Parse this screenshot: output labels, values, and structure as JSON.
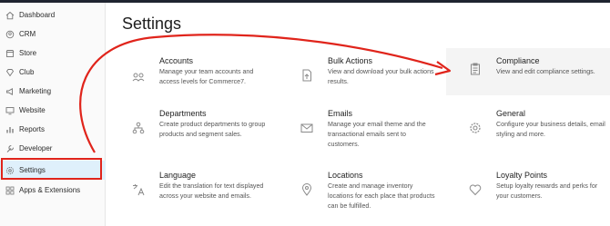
{
  "sidebar": {
    "items": [
      {
        "label": "Dashboard",
        "icon": "home-icon"
      },
      {
        "label": "CRM",
        "icon": "users-icon"
      },
      {
        "label": "Store",
        "icon": "store-icon"
      },
      {
        "label": "Club",
        "icon": "club-icon"
      },
      {
        "label": "Marketing",
        "icon": "megaphone-icon"
      },
      {
        "label": "Website",
        "icon": "monitor-icon"
      },
      {
        "label": "Reports",
        "icon": "chart-icon"
      },
      {
        "label": "Developer",
        "icon": "wrench-icon"
      },
      {
        "label": "Settings",
        "icon": "gear-icon",
        "active": true
      },
      {
        "label": "Apps & Extensions",
        "icon": "grid-icon"
      }
    ]
  },
  "main": {
    "title": "Settings",
    "cards": [
      {
        "title": "Accounts",
        "desc": "Manage your team accounts and access levels for Commerce7.",
        "icon": "accounts-icon"
      },
      {
        "title": "Bulk Actions",
        "desc": "View and download your bulk actions results.",
        "icon": "file-upload-icon"
      },
      {
        "title": "Compliance",
        "desc": "View and edit compliance settings.",
        "icon": "clipboard-icon",
        "highlighted": true
      },
      {
        "title": "Departments",
        "desc": "Create product departments to group products and segment sales.",
        "icon": "departments-icon"
      },
      {
        "title": "Emails",
        "desc": "Manage your email theme and the transactional emails sent to customers.",
        "icon": "envelope-icon"
      },
      {
        "title": "General",
        "desc": "Configure your business details, email styling and more.",
        "icon": "gear-icon"
      },
      {
        "title": "Language",
        "desc": "Edit the translation for text displayed across your website and emails.",
        "icon": "translate-icon"
      },
      {
        "title": "Locations",
        "desc": "Create and manage inventory locations for each place that products can be fulfilled.",
        "icon": "map-pin-icon"
      },
      {
        "title": "Loyalty Points",
        "desc": "Setup loyalty rewards and perks for your customers.",
        "icon": "heart-icon"
      }
    ]
  },
  "colors": {
    "annotation": "#e0241b",
    "active_nav": "#dff0fb",
    "highlight_card": "#f4f4f4"
  }
}
